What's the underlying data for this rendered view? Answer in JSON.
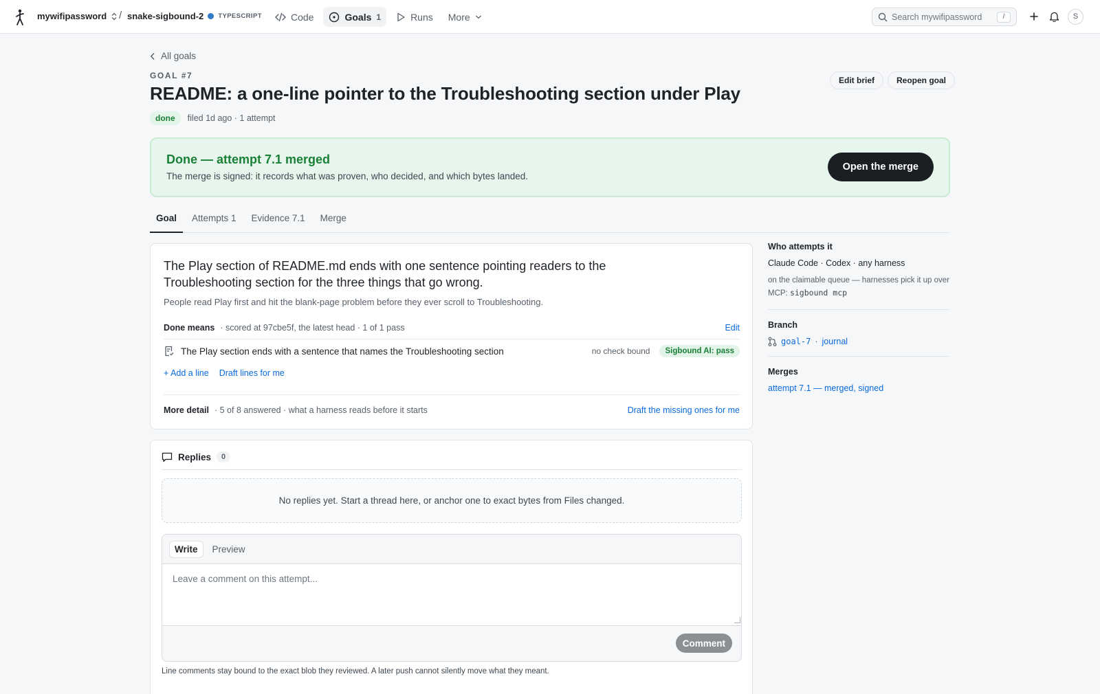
{
  "topbar": {
    "org": "mywifipassword",
    "separator": "/",
    "repo": "snake-sigbound-2",
    "language": "TYPESCRIPT",
    "nav": {
      "code": "Code",
      "goals": "Goals",
      "goals_count": "1",
      "runs": "Runs",
      "more": "More"
    },
    "search_placeholder": "Search mywifipassword",
    "search_shortcut": "/",
    "avatar_initial": "S"
  },
  "header": {
    "back_label": "All goals",
    "eyebrow": "GOAL #7",
    "title": "README: a one-line pointer to the Troubleshooting section under Play",
    "status": "done",
    "meta": "filed 1d ago · 1 attempt",
    "edit_brief": "Edit brief",
    "reopen_goal": "Reopen goal"
  },
  "banner": {
    "title": "Done — attempt 7.1 merged",
    "subtitle": "The merge is signed: it records what was proven, who decided, and which bytes landed.",
    "button": "Open the merge"
  },
  "tabs": [
    "Goal",
    "Attempts 1",
    "Evidence 7.1",
    "Merge"
  ],
  "goal": {
    "headline": "The Play section of README.md ends with one sentence pointing readers to the Troubleshooting section for the three things that go wrong.",
    "subtext": "People read Play first and hit the blank-page problem before they ever scroll to Troubleshooting.",
    "done_means_label": "Done means",
    "done_means_meta": "· scored at 97cbe5f, the latest head · 1 of 1 pass",
    "edit": "Edit",
    "line_text": "The Play section ends with a sentence that names the Troubleshooting section",
    "no_check": "no check bound",
    "pass_badge": "Sigbound AI: pass",
    "add_line": "+ Add a line",
    "draft_lines": "Draft lines for me",
    "more_detail_label": "More detail",
    "more_detail_meta": "· 5 of 8 answered · what a harness reads before it starts",
    "draft_missing": "Draft the missing ones for me"
  },
  "replies": {
    "title": "Replies",
    "count": "0",
    "empty": "No replies yet. Start a thread here, or anchor one to exact bytes from Files changed.",
    "tab_write": "Write",
    "tab_preview": "Preview",
    "placeholder": "Leave a comment on this attempt...",
    "comment_button": "Comment",
    "footnote": "Line comments stay bound to the exact blob they reviewed. A later push cannot silently move what they meant."
  },
  "sidebar": {
    "who_title": "Who attempts it",
    "who_text": "Claude Code · Codex · any harness",
    "who_sub": "on the claimable queue — harnesses pick it up over MCP:",
    "who_cmd": "sigbound mcp",
    "branch_title": "Branch",
    "branch_name": "goal-7",
    "branch_dot": "·",
    "branch_journal": "journal",
    "merges_title": "Merges",
    "merges_link": "attempt 7.1 — merged, signed"
  }
}
